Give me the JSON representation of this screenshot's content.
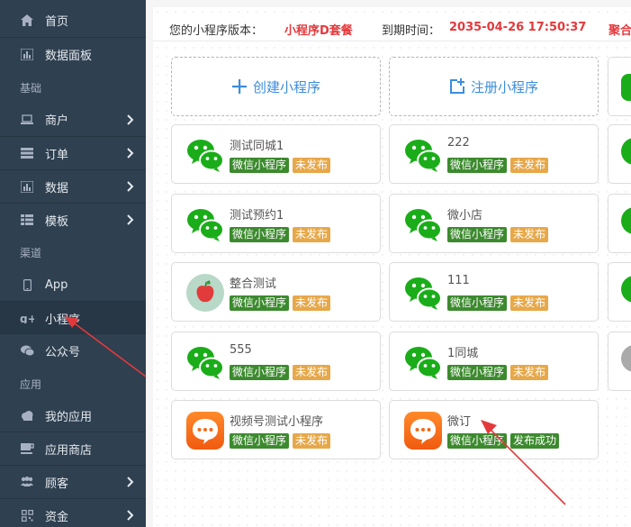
{
  "sidebar": {
    "items": [
      {
        "label": "首页",
        "icon": "home-icon"
      },
      {
        "label": "数据面板",
        "icon": "bar-chart-icon"
      },
      {
        "label": "商户",
        "icon": "laptop-icon"
      },
      {
        "label": "订单",
        "icon": "list-icon"
      },
      {
        "label": "数据",
        "icon": "bar-chart-icon"
      },
      {
        "label": "模板",
        "icon": "grid-icon"
      },
      {
        "label": "App",
        "icon": "mobile-icon"
      },
      {
        "label": "小程序",
        "icon": "google-plus-icon"
      },
      {
        "label": "公众号",
        "icon": "chat-icon"
      },
      {
        "label": "我的应用",
        "icon": "cloud-icon"
      },
      {
        "label": "应用商店",
        "icon": "cup-icon"
      },
      {
        "label": "顾客",
        "icon": "users-icon"
      },
      {
        "label": "资金",
        "icon": "qrcode-icon"
      }
    ],
    "sections": [
      "基础",
      "渠道",
      "应用"
    ]
  },
  "version_bar": {
    "version_label": "您的小程序版本：",
    "version_value": "小程序D套餐",
    "expire_label": "到期时间：",
    "expire_value": "2035-04-26 17:50:37",
    "extra_value": "聚合"
  },
  "actions": {
    "create": "创建小程序",
    "register": "注册小程序"
  },
  "apps": [
    {
      "name": "测试同城1",
      "platform": "微信小程序",
      "status": "未发布",
      "icon": "wechat-icon"
    },
    {
      "name": "222",
      "platform": "微信小程序",
      "status": "未发布",
      "icon": "wechat-icon"
    },
    {
      "name": "测试预约1",
      "platform": "微信小程序",
      "status": "未发布",
      "icon": "wechat-icon"
    },
    {
      "name": "微小店",
      "platform": "微信小程序",
      "status": "未发布",
      "icon": "wechat-icon"
    },
    {
      "name": "整合测试",
      "platform": "微信小程序",
      "status": "未发布",
      "icon": "apple-icon"
    },
    {
      "name": "111",
      "platform": "微信小程序",
      "status": "未发布",
      "icon": "wechat-icon"
    },
    {
      "name": "555",
      "platform": "微信小程序",
      "status": "未发布",
      "icon": "wechat-icon"
    },
    {
      "name": "1同城",
      "platform": "微信小程序",
      "status": "未发布",
      "icon": "wechat-icon"
    },
    {
      "name": "视频号测试小程序",
      "platform": "微信小程序",
      "status": "未发布",
      "icon": "chat-bubble-icon"
    },
    {
      "name": "微订",
      "platform": "微信小程序",
      "status": "发布成功",
      "icon": "chat-bubble-icon"
    }
  ],
  "colors": {
    "sidebar_bg": "#2f4050",
    "accent_blue": "#3c8dde",
    "badge_green": "#3c8a2e",
    "badge_orange": "#e7a84a",
    "wechat_green": "#1aad19",
    "highlight_red": "#e4393c"
  }
}
